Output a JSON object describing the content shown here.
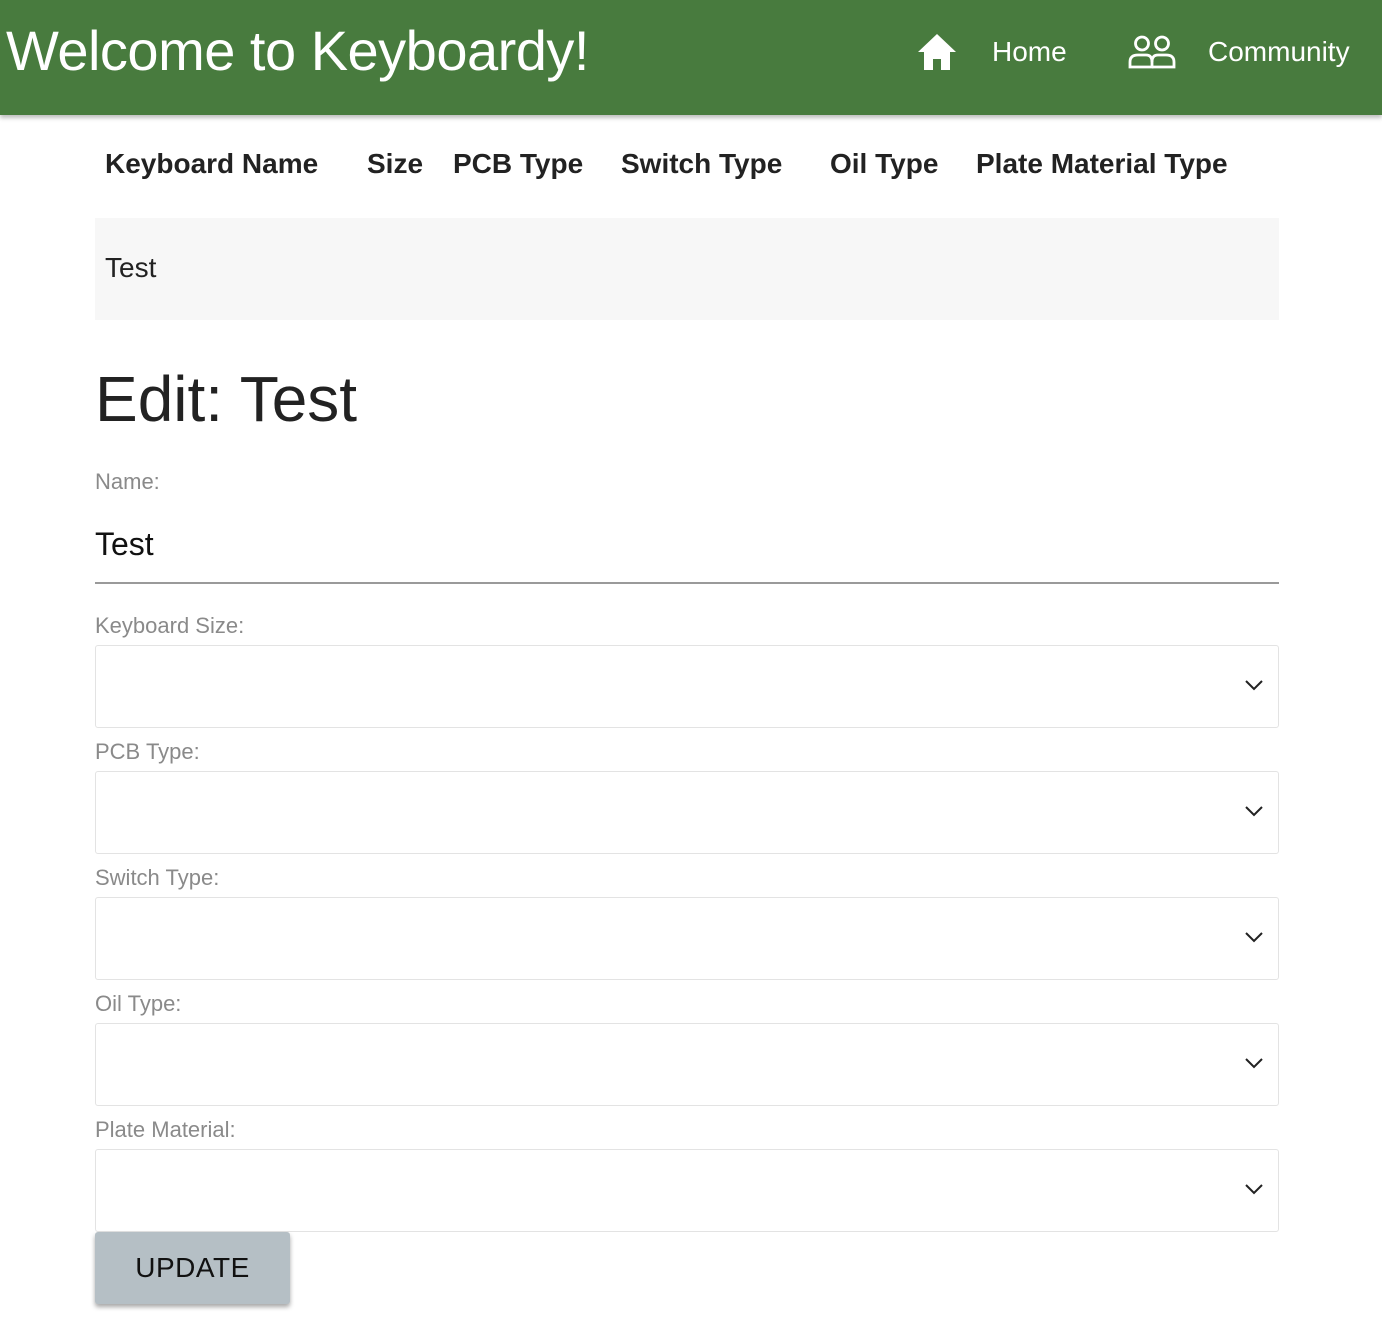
{
  "header": {
    "title": "Welcome to Keyboardy!",
    "nav": [
      {
        "label": "Home",
        "icon": "home-icon"
      },
      {
        "label": "Community",
        "icon": "people-icon"
      }
    ],
    "background_color": "#487b3e"
  },
  "table": {
    "columns": [
      "Keyboard Name",
      "Size",
      "PCB Type",
      "Switch Type",
      "Oil Type",
      "Plate Material Type"
    ],
    "rows": [
      [
        "Test",
        "",
        "",
        "",
        "",
        ""
      ]
    ]
  },
  "edit_form": {
    "title": "Edit: Test",
    "name_label": "Name:",
    "name_value": "Test",
    "fields": [
      {
        "label": "Keyboard Size:",
        "value": ""
      },
      {
        "label": "PCB Type:",
        "value": ""
      },
      {
        "label": "Switch Type:",
        "value": ""
      },
      {
        "label": "Oil Type:",
        "value": ""
      },
      {
        "label": "Plate Material:",
        "value": ""
      }
    ],
    "submit_label": "UPDATE"
  }
}
